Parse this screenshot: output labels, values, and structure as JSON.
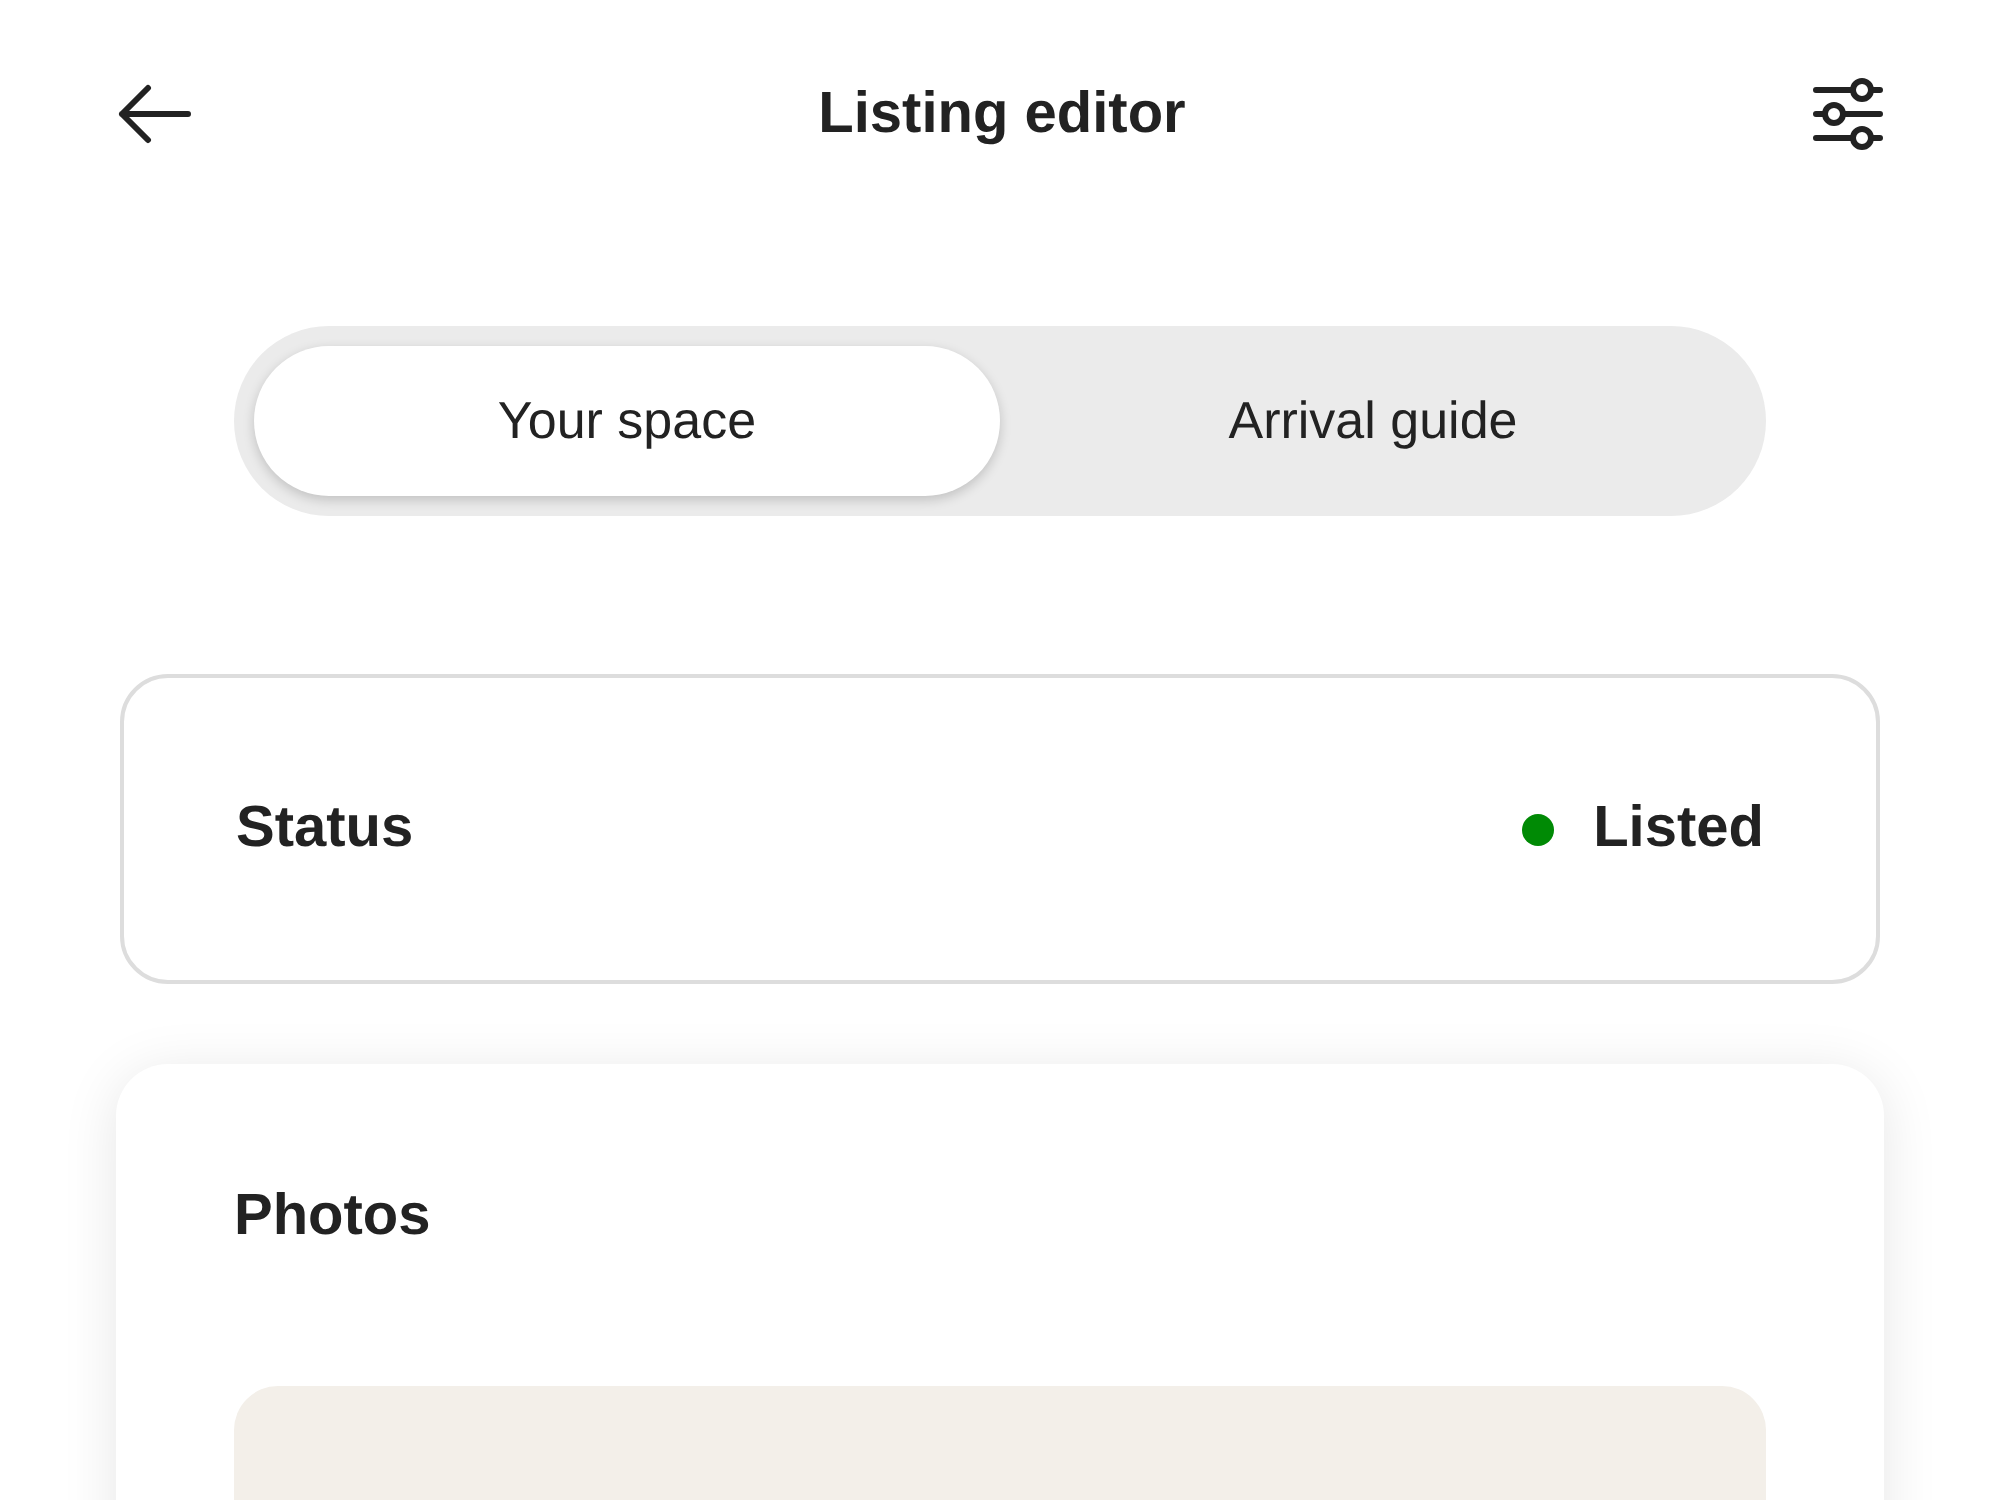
{
  "header": {
    "title": "Listing editor"
  },
  "tabs": [
    {
      "label": "Your space",
      "selected": true
    },
    {
      "label": "Arrival guide",
      "selected": false
    }
  ],
  "status_card": {
    "label": "Status",
    "value": "Listed",
    "color": "#008a05"
  },
  "photos_card": {
    "title": "Photos"
  }
}
